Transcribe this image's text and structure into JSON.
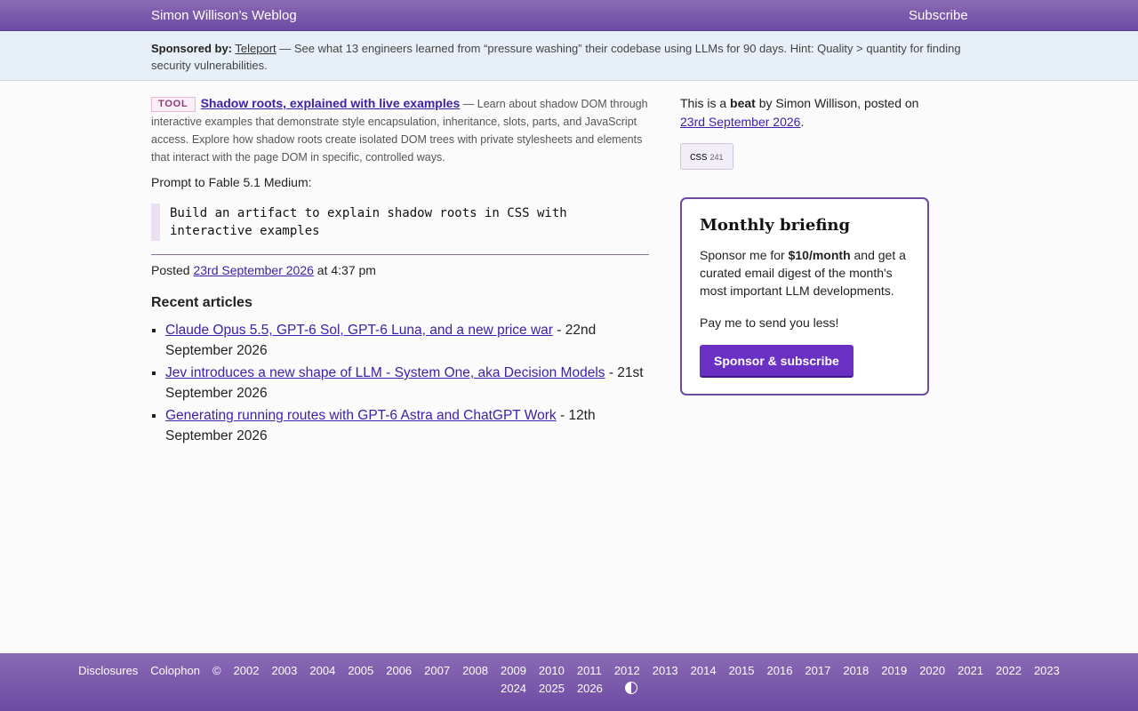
{
  "header": {
    "site_title": "Simon Willison’s Weblog",
    "subscribe": "Subscribe"
  },
  "sponsor": {
    "label": "Sponsored by:",
    "name": "Teleport",
    "text": " — See what 13 engineers learned from “pressure washing” their codebase using LLMs for 90 days. Hint: Quality > quantity for finding security vulnerabilities."
  },
  "main": {
    "badge": "TOOL",
    "title": "Shadow roots, explained with live examples",
    "description": " — Learn about shadow DOM through interactive examples that demonstrate style encapsulation, inheritance, slots, parts, and JavaScript access. Explore how shadow roots create isolated DOM trees with private stylesheets and elements that interact with the page DOM in specific, controlled ways.",
    "prompt_label": "Prompt to Fable 5.1 Medium:",
    "quote": "Build an artifact to explain shadow roots in CSS with\ninteractive examples",
    "posted_prefix": "Posted ",
    "posted_date": "23rd September 2026",
    "posted_time": " at 4:37 pm",
    "recent_heading": "Recent articles",
    "recent": [
      {
        "title": "Claude Opus 5.5, GPT-6 Sol, GPT-6 Luna, and a new price war",
        "date": " - 22nd September 2026"
      },
      {
        "title": "Jev introduces a new shape of LLM - System One, aka Decision Models",
        "date": " - 21st September 2026"
      },
      {
        "title": "Generating running routes with GPT-6 Astra and ChatGPT Work",
        "date": " - 12th September 2026"
      }
    ]
  },
  "sidebar": {
    "meta_prefix": "This is a ",
    "meta_bold": "beat",
    "meta_middle": " by Simon Willison, posted on ",
    "meta_date": "23rd September 2026",
    "meta_suffix": ".",
    "tag": "css",
    "tag_count": "241"
  },
  "briefing": {
    "title": "Monthly briefing",
    "text_prefix": "Sponsor me for ",
    "price": "$10/month",
    "text_suffix": " and get a curated email digest of the month's most important LLM developments.",
    "text2": "Pay me to send you less!",
    "button": "Sponsor & subscribe"
  },
  "footer": {
    "links": [
      "Disclosures",
      "Colophon",
      "©",
      "2002",
      "2003",
      "2004",
      "2005",
      "2006",
      "2007",
      "2008",
      "2009",
      "2010",
      "2011",
      "2012",
      "2013",
      "2014",
      "2015",
      "2016",
      "2017",
      "2018",
      "2019",
      "2020",
      "2021",
      "2022",
      "2023"
    ],
    "links2": [
      "2024",
      "2025",
      "2026"
    ],
    "contrast_icon": "contrast-icon"
  },
  "colors": {
    "accent": "#6d4aa3",
    "link": "#3d21a8",
    "sponsor_bg": "#e7f0f8",
    "button": "#6a30c4"
  }
}
